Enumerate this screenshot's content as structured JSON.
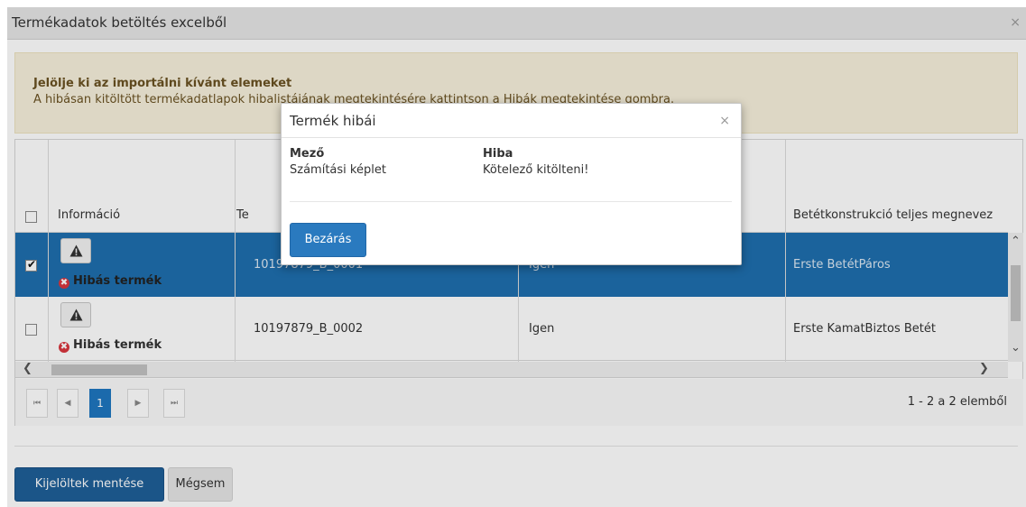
{
  "dialog": {
    "title": "Termékadatok betöltés excelből",
    "close": "×"
  },
  "alert": {
    "title": "Jelölje ki az importálni kívánt elemeket",
    "text": "A hibásan kitöltött termékadatlapok hibalistájának megtekintésére kattintson a Hibák megtekintése gombra."
  },
  "grid": {
    "columns": [
      "Információ",
      "Te",
      "Betétkonstrukció teljes megnevez"
    ],
    "rows": [
      {
        "selected": true,
        "status": "Hibás termék",
        "code": "10197879_B_0001",
        "flag": "Igen",
        "name": "Erste BetétPáros"
      },
      {
        "selected": false,
        "status": "Hibás termék",
        "code": "10197879_B_0002",
        "flag": "Igen",
        "name": "Erste KamatBiztos Betét"
      }
    ]
  },
  "pager": {
    "first": "⏮",
    "prev": "◀",
    "page": "1",
    "next": "▶",
    "last": "⏭",
    "info": "1 - 2 a 2 elemből"
  },
  "footer": {
    "save": "Kijelöltek mentése",
    "cancel": "Mégsem"
  },
  "modal": {
    "title": "Termék hibái",
    "close": "×",
    "col_field": "Mező",
    "col_error": "Hiba",
    "field_value": "Számítási képlet",
    "error_value": "Kötelező kitölteni!",
    "button": "Bezárás"
  },
  "colors": {
    "selected_row": "#1f6fae",
    "primary_button": "#1f5f98",
    "error_icon": "#d9363e",
    "alert_bg": "#f6f0dc"
  }
}
